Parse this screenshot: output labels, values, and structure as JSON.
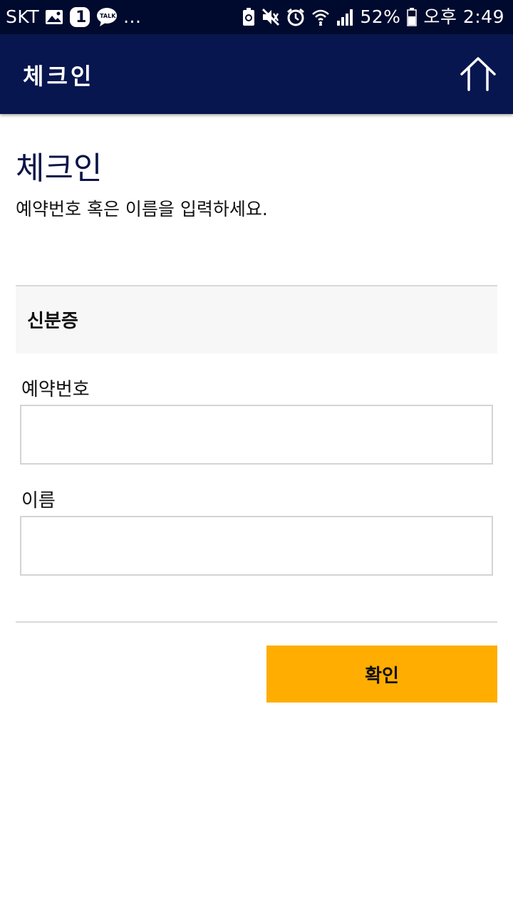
{
  "status_bar": {
    "carrier": "SKT",
    "notification_badge": "1",
    "talk_label": "TALK",
    "more_dots": "...",
    "battery_percent": "52%",
    "time": "오후 2:49",
    "icons": [
      "gallery-icon",
      "kakaotalk-icon",
      "recycle-battery-icon",
      "mute-icon",
      "alarm-icon",
      "wifi-icon",
      "signal-icon",
      "battery-icon"
    ]
  },
  "app_bar": {
    "title": "체크인",
    "home_icon": "home-icon",
    "background_color": "#07164e"
  },
  "main": {
    "heading": "체크인",
    "description": "예약번호 혹은 이름을 입력하세요.",
    "section_title": "신분증",
    "fields": [
      {
        "label": "예약번호",
        "value": "",
        "placeholder": ""
      },
      {
        "label": "이름",
        "value": "",
        "placeholder": ""
      }
    ],
    "confirm_label": "확인",
    "confirm_color": "#ffad00"
  }
}
